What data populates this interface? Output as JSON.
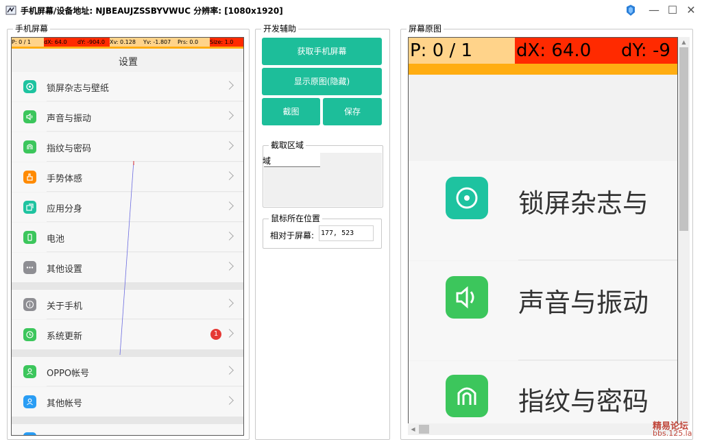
{
  "window": {
    "title": "手机屏幕/设备地址: NJBEAUJZSSBYVWUC 分辨率: [1080x1920]",
    "minimize": "—",
    "maximize": "☐",
    "close": "✕"
  },
  "groups": {
    "phone_screen": "手机屏幕",
    "dev_tools": "开发辅助",
    "raw_screen": "屏幕原图",
    "capture_area": "截取区域",
    "mouse_position": "鼠标所在位置"
  },
  "debug_bar": {
    "p": "P: 0 / 1",
    "dx": "dX: 64.0",
    "dy": "dY: -904.0",
    "xv": "Xv: 0.128",
    "yv": "Yv: -1.807",
    "prs": "Prs: 0.0",
    "size": "Size: 1.0"
  },
  "phone": {
    "header_title": "设置",
    "items": [
      {
        "label": "锁屏杂志与壁纸",
        "icon": "pinwheel-icon",
        "color": "#1ec3a0"
      },
      {
        "label": "声音与振动",
        "icon": "speaker-icon",
        "color": "#3cc65c"
      },
      {
        "label": "指纹与密码",
        "icon": "fingerprint-icon",
        "color": "#3cc65c"
      },
      {
        "label": "手势体感",
        "icon": "hand-icon",
        "color": "#ff8a00"
      },
      {
        "label": "应用分身",
        "icon": "clone-icon",
        "color": "#1ec3a0"
      },
      {
        "label": "电池",
        "icon": "battery-icon",
        "color": "#3cc65c"
      },
      {
        "label": "其他设置",
        "icon": "more-icon",
        "color": "#8e8e93"
      },
      {
        "label": "关于手机",
        "icon": "info-icon",
        "color": "#8e8e93"
      },
      {
        "label": "系统更新",
        "icon": "update-icon",
        "color": "#3cc65c",
        "badge": "1"
      },
      {
        "label": "OPPO帐号",
        "icon": "user-icon",
        "color": "#3cc65c"
      },
      {
        "label": "其他帐号",
        "icon": "user-icon",
        "color": "#2a9df4"
      }
    ]
  },
  "dev": {
    "get_screen": "获取手机屏幕",
    "show_original": "显示原图(隐藏)",
    "screenshot": "截图",
    "save": "保存",
    "capture_text": "域",
    "relative_label": "相对于屏幕:",
    "relative_value": "177, 523"
  },
  "raw": {
    "p": "P: 0 / 1",
    "dx": "dX: 64.0",
    "dy": "dY: -9",
    "items": [
      {
        "label": "锁屏杂志与",
        "icon": "pinwheel-icon",
        "color": "#1ec3a0"
      },
      {
        "label": "声音与振动",
        "icon": "speaker-icon",
        "color": "#3cc65c"
      },
      {
        "label": "指纹与密码",
        "icon": "fingerprint-icon",
        "color": "#3cc65c"
      }
    ]
  },
  "watermark": {
    "line1": "精易论坛",
    "line2": "bbs.125.la"
  },
  "colors": {
    "button_green": "#1dbe9a",
    "debug_yellow": "#ffd38a",
    "debug_red": "#ff2a00",
    "debug_orange": "#ffad12"
  }
}
